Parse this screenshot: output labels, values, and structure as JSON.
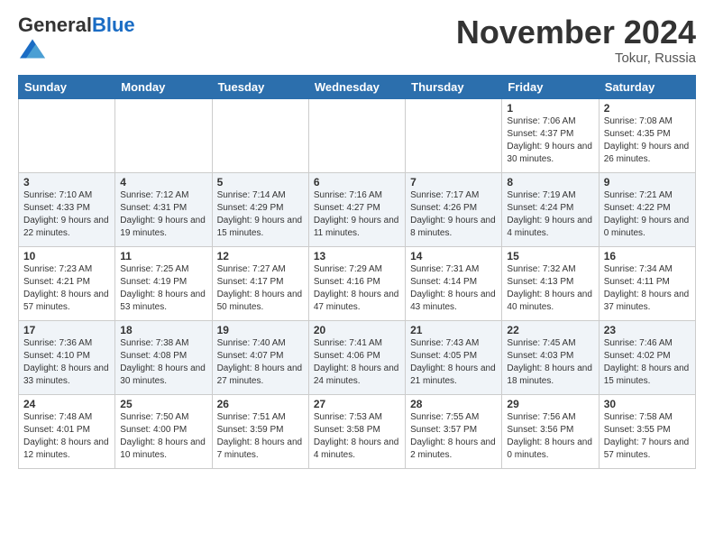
{
  "header": {
    "logo_general": "General",
    "logo_blue": "Blue",
    "month_title": "November 2024",
    "location": "Tokur, Russia"
  },
  "weekdays": [
    "Sunday",
    "Monday",
    "Tuesday",
    "Wednesday",
    "Thursday",
    "Friday",
    "Saturday"
  ],
  "weeks": [
    [
      {
        "day": "",
        "info": ""
      },
      {
        "day": "",
        "info": ""
      },
      {
        "day": "",
        "info": ""
      },
      {
        "day": "",
        "info": ""
      },
      {
        "day": "",
        "info": ""
      },
      {
        "day": "1",
        "info": "Sunrise: 7:06 AM\nSunset: 4:37 PM\nDaylight: 9 hours and 30 minutes."
      },
      {
        "day": "2",
        "info": "Sunrise: 7:08 AM\nSunset: 4:35 PM\nDaylight: 9 hours and 26 minutes."
      }
    ],
    [
      {
        "day": "3",
        "info": "Sunrise: 7:10 AM\nSunset: 4:33 PM\nDaylight: 9 hours and 22 minutes."
      },
      {
        "day": "4",
        "info": "Sunrise: 7:12 AM\nSunset: 4:31 PM\nDaylight: 9 hours and 19 minutes."
      },
      {
        "day": "5",
        "info": "Sunrise: 7:14 AM\nSunset: 4:29 PM\nDaylight: 9 hours and 15 minutes."
      },
      {
        "day": "6",
        "info": "Sunrise: 7:16 AM\nSunset: 4:27 PM\nDaylight: 9 hours and 11 minutes."
      },
      {
        "day": "7",
        "info": "Sunrise: 7:17 AM\nSunset: 4:26 PM\nDaylight: 9 hours and 8 minutes."
      },
      {
        "day": "8",
        "info": "Sunrise: 7:19 AM\nSunset: 4:24 PM\nDaylight: 9 hours and 4 minutes."
      },
      {
        "day": "9",
        "info": "Sunrise: 7:21 AM\nSunset: 4:22 PM\nDaylight: 9 hours and 0 minutes."
      }
    ],
    [
      {
        "day": "10",
        "info": "Sunrise: 7:23 AM\nSunset: 4:21 PM\nDaylight: 8 hours and 57 minutes."
      },
      {
        "day": "11",
        "info": "Sunrise: 7:25 AM\nSunset: 4:19 PM\nDaylight: 8 hours and 53 minutes."
      },
      {
        "day": "12",
        "info": "Sunrise: 7:27 AM\nSunset: 4:17 PM\nDaylight: 8 hours and 50 minutes."
      },
      {
        "day": "13",
        "info": "Sunrise: 7:29 AM\nSunset: 4:16 PM\nDaylight: 8 hours and 47 minutes."
      },
      {
        "day": "14",
        "info": "Sunrise: 7:31 AM\nSunset: 4:14 PM\nDaylight: 8 hours and 43 minutes."
      },
      {
        "day": "15",
        "info": "Sunrise: 7:32 AM\nSunset: 4:13 PM\nDaylight: 8 hours and 40 minutes."
      },
      {
        "day": "16",
        "info": "Sunrise: 7:34 AM\nSunset: 4:11 PM\nDaylight: 8 hours and 37 minutes."
      }
    ],
    [
      {
        "day": "17",
        "info": "Sunrise: 7:36 AM\nSunset: 4:10 PM\nDaylight: 8 hours and 33 minutes."
      },
      {
        "day": "18",
        "info": "Sunrise: 7:38 AM\nSunset: 4:08 PM\nDaylight: 8 hours and 30 minutes."
      },
      {
        "day": "19",
        "info": "Sunrise: 7:40 AM\nSunset: 4:07 PM\nDaylight: 8 hours and 27 minutes."
      },
      {
        "day": "20",
        "info": "Sunrise: 7:41 AM\nSunset: 4:06 PM\nDaylight: 8 hours and 24 minutes."
      },
      {
        "day": "21",
        "info": "Sunrise: 7:43 AM\nSunset: 4:05 PM\nDaylight: 8 hours and 21 minutes."
      },
      {
        "day": "22",
        "info": "Sunrise: 7:45 AM\nSunset: 4:03 PM\nDaylight: 8 hours and 18 minutes."
      },
      {
        "day": "23",
        "info": "Sunrise: 7:46 AM\nSunset: 4:02 PM\nDaylight: 8 hours and 15 minutes."
      }
    ],
    [
      {
        "day": "24",
        "info": "Sunrise: 7:48 AM\nSunset: 4:01 PM\nDaylight: 8 hours and 12 minutes."
      },
      {
        "day": "25",
        "info": "Sunrise: 7:50 AM\nSunset: 4:00 PM\nDaylight: 8 hours and 10 minutes."
      },
      {
        "day": "26",
        "info": "Sunrise: 7:51 AM\nSunset: 3:59 PM\nDaylight: 8 hours and 7 minutes."
      },
      {
        "day": "27",
        "info": "Sunrise: 7:53 AM\nSunset: 3:58 PM\nDaylight: 8 hours and 4 minutes."
      },
      {
        "day": "28",
        "info": "Sunrise: 7:55 AM\nSunset: 3:57 PM\nDaylight: 8 hours and 2 minutes."
      },
      {
        "day": "29",
        "info": "Sunrise: 7:56 AM\nSunset: 3:56 PM\nDaylight: 8 hours and 0 minutes."
      },
      {
        "day": "30",
        "info": "Sunrise: 7:58 AM\nSunset: 3:55 PM\nDaylight: 7 hours and 57 minutes."
      }
    ]
  ]
}
